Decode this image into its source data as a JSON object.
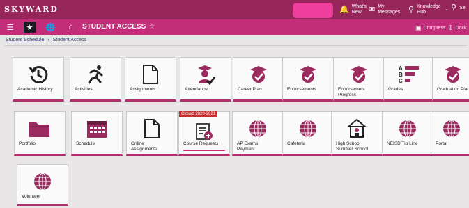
{
  "brand": {
    "logo_text": "SKYWARD",
    "accent": "#96265a",
    "accent_light": "#c32e7b"
  },
  "header": {
    "whats_new": "What's New",
    "my_messages": "My Messages",
    "knowledge_hub": "Knowledge Hub",
    "search_partial": "Se"
  },
  "nav": {
    "title": "STUDENT ACCESS",
    "compress": "Compress",
    "dock": "Dock"
  },
  "breadcrumb": [
    "Student Schedule",
    "Student Access"
  ],
  "tiles": [
    {
      "label": "Academic History",
      "icon": "history-icon"
    },
    {
      "label": "Activities",
      "icon": "running-person-icon"
    },
    {
      "label": "Assignments",
      "icon": "document-icon"
    },
    {
      "label": "Attendance",
      "icon": "graduate-check-icon"
    },
    {
      "label": "Career Plan",
      "icon": "badge-check-icon"
    },
    {
      "label": "Endorsements",
      "icon": "badge-check-icon"
    },
    {
      "label": "Endorsement Progress",
      "icon": "badge-check-icon"
    },
    {
      "label": "Grades",
      "icon": "abc-list-icon"
    },
    {
      "label": "Graduation Plan",
      "icon": "badge-check-icon"
    },
    {
      "label": "Portfolio",
      "icon": "folder-icon"
    },
    {
      "label": "Schedule",
      "icon": "calendar-icon"
    },
    {
      "label": "Online Assignments",
      "icon": "document-icon"
    },
    {
      "label": "Course Requests",
      "icon": "course-request-icon",
      "tag": "Closed 2020-2021"
    },
    {
      "label": "AP Exams Payment",
      "icon": "globe-icon"
    },
    {
      "label": "Cafeteria",
      "icon": "globe-icon"
    },
    {
      "label": "High School Summer School",
      "icon": "school-house-icon"
    },
    {
      "label": "NEISD Tip Line",
      "icon": "globe-icon"
    },
    {
      "label": "Portal",
      "icon": "globe-icon"
    },
    {
      "label": "Volunteer",
      "icon": "globe-icon"
    }
  ]
}
